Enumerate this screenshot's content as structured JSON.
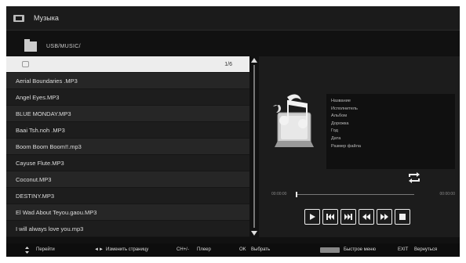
{
  "app": {
    "title": "Музыка",
    "path": "USB/MUSIC/"
  },
  "list": {
    "page": "1/6",
    "items": [
      "Aerial Boundaries .MP3",
      "Angel Eyes.MP3",
      "BLUE MONDAY.MP3",
      "Baai Tsh.noh .MP3",
      "Boom Boom Boom!!.mp3",
      "Cayuse Flute.MP3",
      "Coconut.MP3",
      "DESTINY.MP3",
      "El Wad About Teyou.gaou.MP3",
      "I will always love you.mp3"
    ]
  },
  "info": {
    "labels": [
      "Название",
      "Исполнитель",
      "Альбом",
      "Дорожка",
      "Год",
      "Дата",
      "Размер файла"
    ]
  },
  "player": {
    "time_start": "00:00:00",
    "time_end": "00:00:00",
    "progress": 0,
    "controls": [
      "play-icon",
      "prev-track-icon",
      "next-track-icon",
      "rewind-icon",
      "fast-forward-icon",
      "stop-icon"
    ]
  },
  "bottom": {
    "move": "Перейти",
    "change_page_key": "◄► ",
    "change_page": "Изменить страницу",
    "ch_key": "CH+/-",
    "player": "Плеер",
    "ok_key": "OK",
    "select": "Выбрать",
    "quick_menu": "Быстрое меню",
    "exit_key": "EXIT",
    "back": "Вернуться"
  },
  "colors": {
    "background": "#111111",
    "selected_row": "#ededed",
    "text": "#dddddd"
  }
}
